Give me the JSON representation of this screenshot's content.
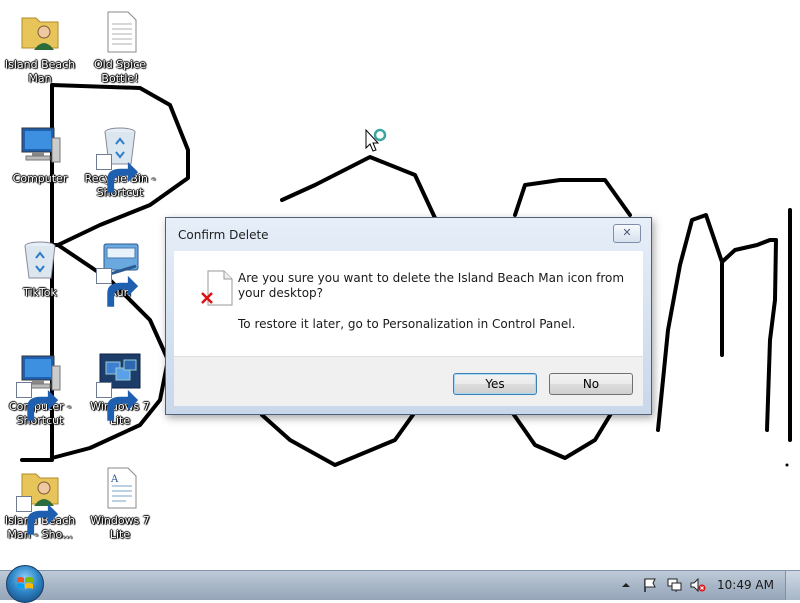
{
  "desktop": {
    "icons": [
      {
        "label": "Island Beach Man",
        "icon": "user-folder-icon",
        "shortcut": false
      },
      {
        "label": "Old Spice Bottle!",
        "icon": "text-document-icon",
        "shortcut": false
      },
      {
        "label": "Computer",
        "icon": "computer-icon",
        "shortcut": false
      },
      {
        "label": "Recycle Bin - Shortcut",
        "icon": "recycle-bin-icon",
        "shortcut": true
      },
      {
        "label": "TikTok",
        "icon": "recycle-bin-icon",
        "shortcut": false
      },
      {
        "label": "Run",
        "icon": "run-icon",
        "shortcut": true
      },
      {
        "label": "Computer - Shortcut",
        "icon": "computer-icon",
        "shortcut": true
      },
      {
        "label": "Windows 7 Lite",
        "icon": "windows-icon",
        "shortcut": true
      },
      {
        "label": "Island Beach Man - Sho...",
        "icon": "user-folder-icon",
        "shortcut": true
      },
      {
        "label": "Windows 7 Lite",
        "icon": "document-icon",
        "shortcut": false
      }
    ]
  },
  "dialog": {
    "title": "Confirm Delete",
    "close_symbol": "✕",
    "message": "Are you sure you want to delete the Island Beach Man icon from your desktop?",
    "hint": "To restore it later, go to Personalization in Control Panel.",
    "yes_label": "Yes",
    "no_label": "No",
    "icon": "deleted-file-icon"
  },
  "taskbar": {
    "time": "10:49 AM",
    "tray_icons": [
      "show-hidden-icons-chevron-icon",
      "action-center-flag-icon",
      "network-icon",
      "volume-muted-icon"
    ]
  }
}
